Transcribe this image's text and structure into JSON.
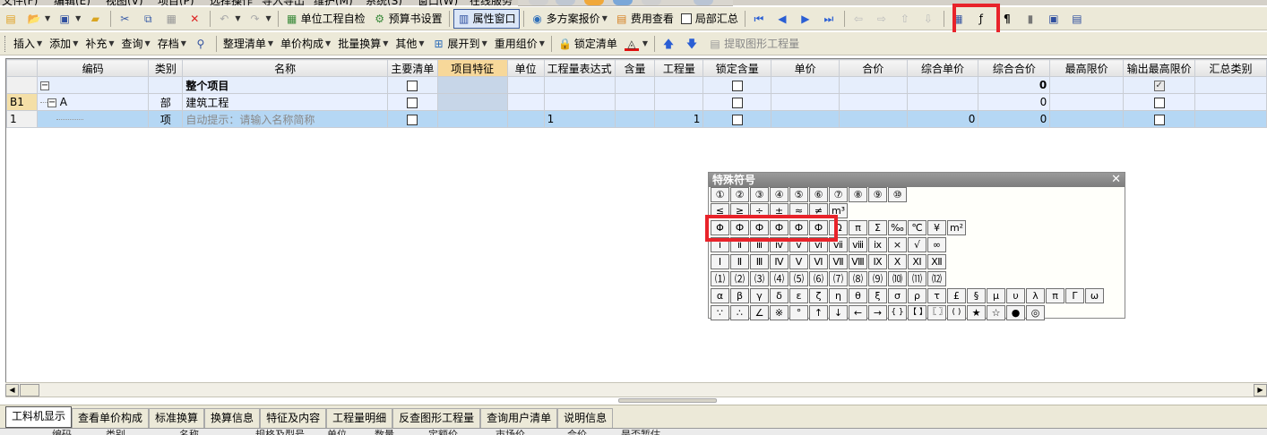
{
  "menubar": [
    "文件(F)",
    "编辑(E)",
    "视图(V)",
    "项目(P)",
    "选择操作",
    "导入导出",
    "维护(M)",
    "系统(S)",
    "窗口(W)",
    "在线服务"
  ],
  "toolbar1": {
    "unit_check": "单位工程自检",
    "budget_settings": "预算书设置",
    "property_window": "属性窗口",
    "multi_quote": "多方案报价",
    "fee_view": "费用查看",
    "local_summary": "局部汇总"
  },
  "toolbar2": {
    "insert": "插入",
    "add": "添加",
    "supplement": "补充",
    "query": "查询",
    "archive": "存档",
    "organize_list": "整理清单",
    "unit_price_composition": "单价构成",
    "batch_convert": "批量换算",
    "other": "其他",
    "expand_to": "展开到",
    "reuse_group_price": "重用组价",
    "lock_list": "锁定清单",
    "extract_graphic_qty": "提取图形工程量"
  },
  "grid": {
    "headers": [
      "编码",
      "类别",
      "名称",
      "主要清单",
      "项目特征",
      "单位",
      "工程量表达式",
      "含量",
      "工程量",
      "锁定含量",
      "单价",
      "合价",
      "综合单价",
      "综合合价",
      "最高限价",
      "输出最高限价",
      "汇总类别"
    ],
    "rows": [
      {
        "rownum": "",
        "code": "",
        "type": "",
        "name": "整个项目",
        "unit": "",
        "expr": "",
        "qty": "",
        "up": "",
        "total": "",
        "cup": "",
        "ctotal": "0",
        "main_checked": false,
        "lock_checked": false,
        "max_checked": true
      },
      {
        "rownum": "B1",
        "code": "A",
        "type": "部",
        "name": "建筑工程",
        "unit": "",
        "expr": "",
        "qty": "",
        "up": "",
        "total": "",
        "cup": "",
        "ctotal": "0",
        "main_checked": false,
        "lock_checked": false,
        "max_checked": false
      },
      {
        "rownum": "1",
        "code": "",
        "type": "项",
        "name": "自动提示：请输入名称简称",
        "unit": "",
        "expr": "1",
        "qty": "1",
        "up": "",
        "total": "",
        "cup": "0",
        "ctotal": "0",
        "main_checked": false,
        "lock_checked": false,
        "max_checked": false
      }
    ]
  },
  "bottom_tabs": [
    "工料机显示",
    "查看单价构成",
    "标准换算",
    "换算信息",
    "特征及内容",
    "工程量明细",
    "反查图形工程量",
    "查询用户清单",
    "说明信息"
  ],
  "bottom_columns": [
    "编码",
    "类别",
    "名称",
    "规格及型号",
    "单位",
    "数量",
    "定额价",
    "市场价",
    "合价",
    "是否暂估"
  ],
  "palette": {
    "title": "特殊符号",
    "close": "✕",
    "rows": [
      [
        "①",
        "②",
        "③",
        "④",
        "⑤",
        "⑥",
        "⑦",
        "⑧",
        "⑨",
        "⑩"
      ],
      [
        "≤",
        "≥",
        "÷",
        "±",
        "≈",
        "≠",
        "m³"
      ],
      [
        "Φ",
        "Ф",
        "Ф",
        "Ф",
        "Ф",
        "Ф",
        "Ω",
        "π",
        "Σ",
        "‰",
        "℃",
        "¥",
        "m²"
      ],
      [
        "ⅰ",
        "ⅱ",
        "ⅲ",
        "ⅳ",
        "ⅴ",
        "ⅵ",
        "ⅶ",
        "ⅷ",
        "ⅸ",
        "×",
        "√",
        "∞"
      ],
      [
        "Ⅰ",
        "Ⅱ",
        "Ⅲ",
        "Ⅳ",
        "Ⅴ",
        "Ⅵ",
        "Ⅶ",
        "Ⅷ",
        "Ⅸ",
        "Ⅹ",
        "Ⅺ",
        "Ⅻ"
      ],
      [
        "⑴",
        "⑵",
        "⑶",
        "⑷",
        "⑸",
        "⑹",
        "⑺",
        "⑻",
        "⑼",
        "⑽",
        "⑾",
        "⑿"
      ],
      [
        "α",
        "β",
        "γ",
        "δ",
        "ε",
        "ζ",
        "η",
        "θ",
        "ξ",
        "σ",
        "ρ",
        "τ",
        "£",
        "§",
        "μ",
        "υ",
        "λ",
        "π",
        "Γ",
        "ω"
      ],
      [
        "∵",
        "∴",
        "∠",
        "※",
        "°",
        "↑",
        "↓",
        "←",
        "→",
        "{ }",
        "【 】",
        "〖 〗",
        "( )",
        "★",
        "☆",
        "●",
        "◎"
      ]
    ]
  },
  "colors": {
    "highlight_box": "#e8232a",
    "selected_row": "#b5d7f4",
    "feature_header": "#f7d89a"
  }
}
